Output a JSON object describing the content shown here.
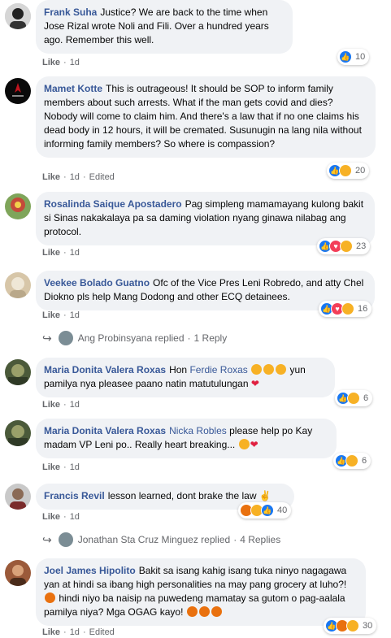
{
  "comments": [
    {
      "name": "Frank Suha",
      "text": "Justice? We are back to the time when Jose Rizal wrote Noli and Fili. Over a hundred years ago. Remember this well.",
      "like": "Like",
      "time": "1d",
      "edited": "",
      "reaction_count": "10"
    },
    {
      "name": "Mamet Kotte",
      "text": "This is outrageous! It should be SOP to inform family members about such arrests. What if the man gets covid and dies? Nobody will come to claim him. And there's a law that if no one claims his dead body in 12 hours, it will be cremated. Susunugin na lang nila without informing family members? So where is compassion?",
      "like": "Like",
      "time": "1d",
      "edited": "Edited",
      "reaction_count": "20"
    },
    {
      "name": "Rosalinda Saique Apostadero",
      "text": "Pag simpleng mamamayang kulong bakit si Sinas nakakalaya pa sa daming violation nyang ginawa nilabag ang protocol.",
      "like": "Like",
      "time": "1d",
      "edited": "",
      "reaction_count": "23"
    },
    {
      "name": "Veekee Bolado Guatno",
      "text": "Ofc of the Vice Pres Leni Robredo, and atty Chel Diokno pls help Mang Dodong and other ECQ detainees.",
      "like": "Like",
      "time": "1d",
      "edited": "",
      "reaction_count": "16"
    },
    {
      "name": "Maria Donita Valera Roxas",
      "tag": "Ferdie Roxas",
      "text_before": "Hon",
      "text_after": "yun pamilya nya pleasee paano natin matutulungan",
      "like": "Like",
      "time": "1d",
      "edited": "",
      "reaction_count": "6"
    },
    {
      "name": "Maria Donita Valera Roxas",
      "tag": "Nicka Robles",
      "text_after": "please help po Kay madam VP Leni po.. Really heart breaking...",
      "like": "Like",
      "time": "1d",
      "edited": "",
      "reaction_count": "6"
    },
    {
      "name": "Francis Revil",
      "text": "lesson learned, dont brake the law",
      "like": "Like",
      "time": "1d",
      "edited": "",
      "reaction_count": "40"
    },
    {
      "name": "Joel James Hipolito",
      "text": "Bakit sa isang kahig isang tuka ninyo nagagawa yan at hindi sa ibang high personalities na may pang grocery at luho?!",
      "text2": "hindi niyo ba naisip na puwedeng mamatay sa gutom o pag-aalala pamilya niya? Mga OGAG kayo!",
      "like": "Like",
      "time": "1d",
      "edited": "Edited",
      "reaction_count": "30"
    }
  ],
  "replies": [
    {
      "author": "Ang Probinsyana",
      "verb": "replied",
      "count": "1 Reply"
    },
    {
      "author": "Jonathan Sta Cruz Minguez",
      "verb": "replied",
      "count": "4 Replies"
    }
  ],
  "separator": "·"
}
